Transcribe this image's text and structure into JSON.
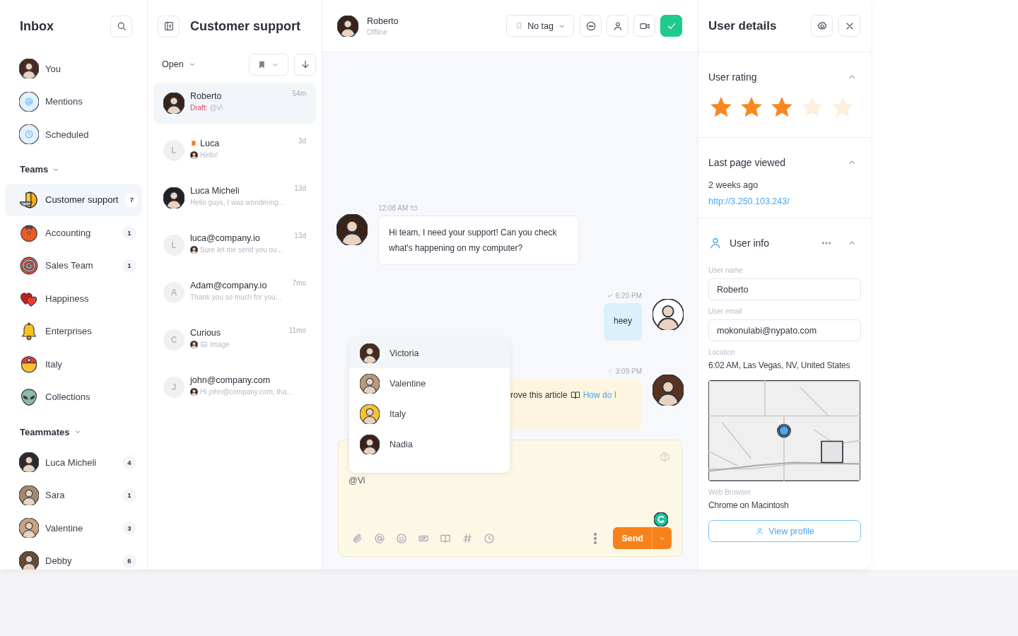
{
  "sidebar": {
    "title": "Inbox",
    "items": [
      {
        "label": "You",
        "kind": "avatar"
      },
      {
        "label": "Mentions",
        "kind": "mentions"
      },
      {
        "label": "Scheduled",
        "kind": "scheduled"
      }
    ],
    "teams_label": "Teams",
    "teams": [
      {
        "label": "Customer support",
        "count": "7",
        "selected": true,
        "kind": "bowl"
      },
      {
        "label": "Accounting",
        "count": "1",
        "selected": false,
        "kind": "toolbox"
      },
      {
        "label": "Sales Team",
        "count": "1",
        "selected": false,
        "kind": "target"
      },
      {
        "label": "Happiness",
        "selected": false,
        "kind": "hearts"
      },
      {
        "label": "Enterprises",
        "selected": false,
        "kind": "bell"
      },
      {
        "label": "Italy",
        "selected": false,
        "kind": "cap"
      },
      {
        "label": "Collections",
        "selected": false,
        "kind": "alien"
      }
    ],
    "teammates_label": "Teammates",
    "teammates": [
      {
        "label": "Luca Micheli",
        "count": "4"
      },
      {
        "label": "Sara",
        "count": "1"
      },
      {
        "label": "Valentine",
        "count": "3"
      },
      {
        "label": "Debby",
        "count": "6"
      }
    ]
  },
  "conversations": {
    "title": "Customer support",
    "filter": "Open",
    "items": [
      {
        "name": "Roberto",
        "time": "54m",
        "draft": "Draft:",
        "preview": "@Vi",
        "flagged": false,
        "agent_reply": false,
        "attachment": false,
        "selected": true
      },
      {
        "name": "Luca",
        "time": "3d",
        "kind": "letter",
        "initial": "L",
        "preview": "Hello!",
        "flagged": true,
        "agent_reply": true,
        "attachment": false,
        "selected": false
      },
      {
        "name": "Luca Micheli",
        "time": "13d",
        "preview": "Hello guys, I was wondering...",
        "flagged": false,
        "agent_reply": false,
        "attachment": false,
        "selected": false
      },
      {
        "name": "luca@company.io",
        "time": "13d",
        "kind": "letter",
        "initial": "L",
        "preview": "Sure let me send you ou...",
        "flagged": false,
        "agent_reply": true,
        "attachment": false,
        "selected": false
      },
      {
        "name": "Adam@company.io",
        "time": "7mo",
        "kind": "letter",
        "initial": "A",
        "preview": "Thank you so much for you...",
        "flagged": false,
        "agent_reply": false,
        "attachment": false,
        "selected": false
      },
      {
        "name": "Curious",
        "time": "11mo",
        "kind": "letter",
        "initial": "C",
        "preview": "Image",
        "flagged": false,
        "agent_reply": true,
        "attachment": true,
        "selected": false
      },
      {
        "name": "john@company.com",
        "kind": "letter",
        "initial": "J",
        "preview": "Hi john@company.com, tha...",
        "flagged": false,
        "agent_reply": true,
        "attachment": false,
        "selected": false
      }
    ]
  },
  "chat": {
    "contact": {
      "name": "Roberto",
      "status": "Offline"
    },
    "tag": "No tag",
    "messages": [
      {
        "kind": "incoming",
        "time": "12:08 AM",
        "via_email": true,
        "text": "Hi team, I need your support! Can you check what's happening on my computer?"
      },
      {
        "kind": "outgoing",
        "time": "6:20 PM",
        "read": true,
        "text": "heey"
      },
      {
        "kind": "note",
        "time": "3:09 PM",
        "read": false,
        "text": "rove this article",
        "link": "How do I"
      }
    ],
    "mention_menu": [
      {
        "label": "Victoria",
        "selected": true
      },
      {
        "label": "Valentine",
        "selected": false
      },
      {
        "label": "Italy",
        "selected": false
      },
      {
        "label": "Nadia",
        "selected": false
      }
    ],
    "composer": {
      "value": "@Vi",
      "send": "Send"
    }
  },
  "details": {
    "title": "User details",
    "rating": {
      "title": "User rating",
      "stars": 3
    },
    "last_page": {
      "title": "Last page viewed",
      "when": "2 weeks ago",
      "url": "http://3.250.103.243/"
    },
    "user_info": {
      "title": "User info",
      "fields": [
        {
          "kind": "input",
          "label": "User name",
          "value": "Roberto"
        },
        {
          "kind": "input",
          "label": "User email",
          "value": "mokonulabi@nypato.com"
        },
        {
          "kind": "text",
          "label": "Location",
          "value": "6:02 AM, Las Vegas, NV, United States"
        },
        {
          "kind": "picture"
        },
        {
          "kind": "text",
          "label": "Web Browser",
          "value": "Chrome on Macintosh"
        }
      ],
      "button": "View profile"
    }
  }
}
